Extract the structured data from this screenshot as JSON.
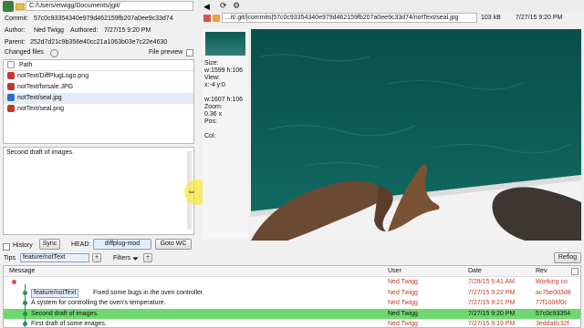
{
  "top": {
    "repo_path": "C:/Users/etwigg/Documents/jgit/",
    "commit_label": "Commit:",
    "commit_hash": "57c0c93354340e979d462159fb207a0ee9c33d74",
    "author_label": "Author:",
    "author_name": "Ned Twigg",
    "authored_label": "Authored:",
    "authored_date": "7/27/15 9:20 PM",
    "parent_label": "Parent:",
    "parent_hash": "252d7d21c9b356e40cc21a1063b03e7c22e4630",
    "changed_files_label": "Changed files",
    "file_preview_label": "File preview",
    "path_header": "Path"
  },
  "files": [
    {
      "name": "notText/DiffPlugLogo.png",
      "status_color": "#c0392b"
    },
    {
      "name": "notText/forsale.JPG",
      "status_color": "#c0392b"
    },
    {
      "name": "notText/seal.jpg",
      "status_color": "#2e6cc7"
    },
    {
      "name": "notText/seal.png",
      "status_color": "#c0392b"
    }
  ],
  "message": "Second draft of images.",
  "history": {
    "label": "History",
    "sync": "Sync",
    "head_label": "HEAD:",
    "head_branch": "diffplug-mod",
    "goto_wc": "Goto WC",
    "tips_label": "Tips",
    "tip_branch": "feature/notText",
    "filters_label": "Filters",
    "reflog": "Reflog"
  },
  "preview": {
    "url": "...it/.git/|commits|57c0c93354340e979d462159fb207a0ee9c33d74/notText/seal.jpg",
    "size": "103 kB",
    "date": "7/27/15 9:20 PM",
    "info": [
      "Size:",
      "w:1599 h:106",
      "View:",
      "x:-4 y:0",
      "",
      "w:1607 h:106",
      "Zoom:",
      "0.36 x",
      "Pos:",
      "",
      "Col:"
    ]
  },
  "table": {
    "headers": [
      "Message",
      "User",
      "Date",
      "Rev"
    ],
    "rows": [
      {
        "branch": "",
        "msg": "",
        "user": "Ned Twigg",
        "date": "7/28/15 5:41 AM",
        "rev": "Working co",
        "style": "top"
      },
      {
        "branch": "feature/notText",
        "msg": "Fixed some bugs in the oven controller.",
        "user": "Ned Twigg",
        "date": "7/27/15 9:22 PM",
        "rev": "ac7be0d3d8",
        "style": "normal"
      },
      {
        "branch": "",
        "msg": "A system for controlling the oven's temperature.",
        "user": "Ned Twigg",
        "date": "7/27/15 9:21 PM",
        "rev": "77f1006f0c",
        "style": "normal"
      },
      {
        "branch": "",
        "msg": "Second draft of images.",
        "user": "Ned Twigg",
        "date": "7/27/15 9:20 PM",
        "rev": "57c0c93354",
        "style": "selected"
      },
      {
        "branch": "",
        "msg": "First draft of some images.",
        "user": "Ned Twigg",
        "date": "7/27/15 9:19 PM",
        "rev": "3edda8c32f",
        "style": "normal"
      }
    ]
  },
  "colors": {
    "accent": "#4caf50",
    "selected": "#6dd86d",
    "water": "#0d5b55"
  }
}
